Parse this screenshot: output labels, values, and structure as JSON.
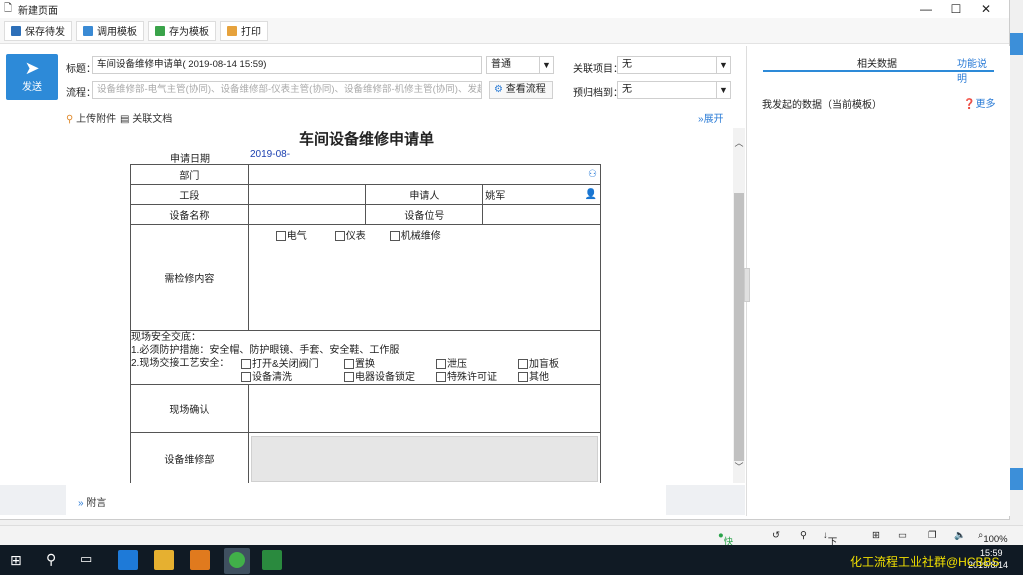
{
  "window": {
    "title": "新建页面",
    "min": "—",
    "max": "☐",
    "close": "✕"
  },
  "toolbar": {
    "save_draft": "保存待发",
    "load_template": "调用模板",
    "save_template": "存为模板",
    "print": "打印"
  },
  "header": {
    "send": "发送",
    "title_label": "标题：",
    "title_value": "车间设备维修申请单(          2019-08-14 15:59)",
    "priority": "普通",
    "related_project_label": "关联项目：",
    "related_project_value": "无",
    "flow_label": "流程：",
    "flow_placeholder": "设备维修部-电气主管(协同)、设备维修部-仪表主管(协同)、设备维修部-机修主管(协同)、发起者(",
    "view_flow": "查看流程",
    "archive_label": "预归档到：",
    "archive_value": "无",
    "upload": "上传附件",
    "related_doc": "关联文档",
    "expand": "展开"
  },
  "form": {
    "heading": "车间设备维修申请单",
    "apply_date_label": "申请日期",
    "apply_date_value": "2019-08-",
    "dept": "部门",
    "section": "工段",
    "applicant_label": "申请人",
    "applicant_value": "姚军",
    "equip_name": "设备名称",
    "equip_pos": "设备位号",
    "repair_content": "需检修内容",
    "opt_electric": "电气",
    "opt_instrument": "仪表",
    "opt_mech": "机械维修",
    "safety_title": "现场安全交底：",
    "safety_line1": "1.必须防护措施：安全帽、防护眼镜、手套、安全鞋、工作服",
    "safety_line2": "2.现场交接工艺安全：",
    "s_open_close": "打开&关闭阀门",
    "s_replace": "置换",
    "s_pressure": "泄压",
    "s_blind": "加盲板",
    "s_clean": "设备清洗",
    "s_lock": "电器设备锁定",
    "s_permit": "特殊许可证",
    "s_other": "其他",
    "site_confirm": "现场确认",
    "repair_dept": "设备维修部"
  },
  "footer": {
    "attachment": "附言"
  },
  "right_panel": {
    "tab1": "相关数据",
    "tab2": "功能说明",
    "my_data": "我发起的数据（当前模板）",
    "more": "更多"
  },
  "statusbar": {
    "clip": "快剪辑",
    "download": "下载",
    "zoom": "100%"
  },
  "taskbar": {
    "time": "15:59",
    "date": "2019/8/14",
    "watermark": "化工流程工业社群@HCBBS"
  },
  "colors": {
    "accent": "#2d8ad8",
    "taskbar": "#101a24"
  }
}
